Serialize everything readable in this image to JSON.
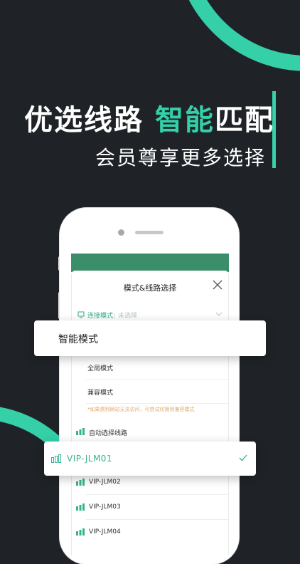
{
  "headline": {
    "part1": "优选线路",
    "part2": "智能",
    "part3": "匹配"
  },
  "subline": "会员尊享更多选择",
  "colors": {
    "background": "#1f2327",
    "accent": "#35cfa8",
    "header_green": "#3a8f6a",
    "note": "#e0a86a"
  },
  "dialog": {
    "title": "模式&线路选择",
    "connection_label": "连接模式:",
    "connection_value": "未选择",
    "modes": [
      "智能模式",
      "全局模式",
      "兼容模式"
    ],
    "note": "*如果遇到网站无法访问，可尝试切换到兼容模式",
    "auto_route": "自动选择线路",
    "selected_route": "VIP-JLM01",
    "routes": [
      "VIP-JLM02",
      "VIP-JLM03",
      "VIP-JLM04"
    ]
  },
  "icons": {
    "close": "close-icon",
    "chevron": "chevron-down-icon",
    "check": "check-icon",
    "signal": "signal-bars-icon",
    "connection": "connection-mode-icon"
  }
}
